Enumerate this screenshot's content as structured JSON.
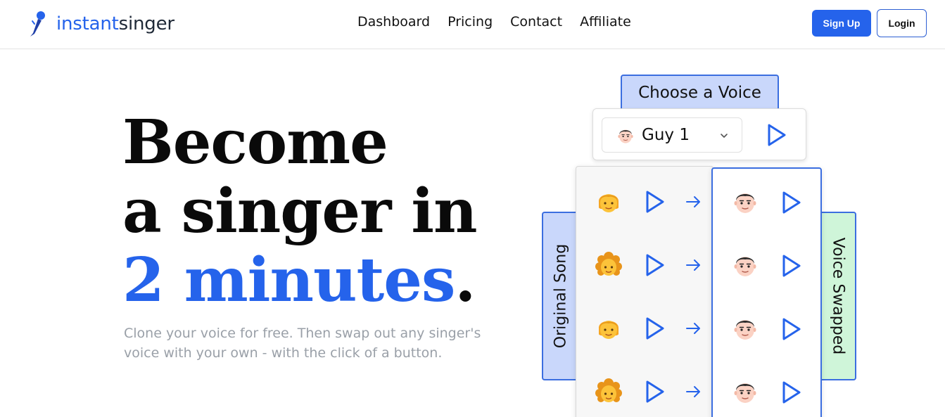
{
  "header": {
    "logo_part1": "instant",
    "logo_part2": "singer",
    "nav": [
      {
        "label": "Dashboard"
      },
      {
        "label": "Pricing"
      },
      {
        "label": "Contact"
      },
      {
        "label": "Affiliate"
      }
    ],
    "signup_label": "Sign Up",
    "login_label": "Login"
  },
  "hero": {
    "line1": "Become",
    "line2": "a singer in",
    "line3_highlight": "2 minutes",
    "line3_dot": ".",
    "subtitle": "Clone your voice for free. Then swap out any singer's voice with your own - with the click of a button."
  },
  "widget": {
    "choose_label": "Choose a Voice",
    "selected_voice": "Guy 1",
    "original_label": "Original Song",
    "swapped_label": "Voice Swapped",
    "rows": [
      {
        "original": "blond-singer-icon",
        "swapped": "guy-face-icon"
      },
      {
        "original": "curly-singer-icon",
        "swapped": "guy-face-icon"
      },
      {
        "original": "blond-singer-icon",
        "swapped": "guy-face-icon"
      },
      {
        "original": "curly-singer-icon",
        "swapped": "guy-face-icon"
      }
    ]
  },
  "colors": {
    "accent": "#2563eb",
    "tab_blue": "#c9d7fb",
    "tab_green": "#cff5d9",
    "subtitle_gray": "#9aa0a8"
  }
}
